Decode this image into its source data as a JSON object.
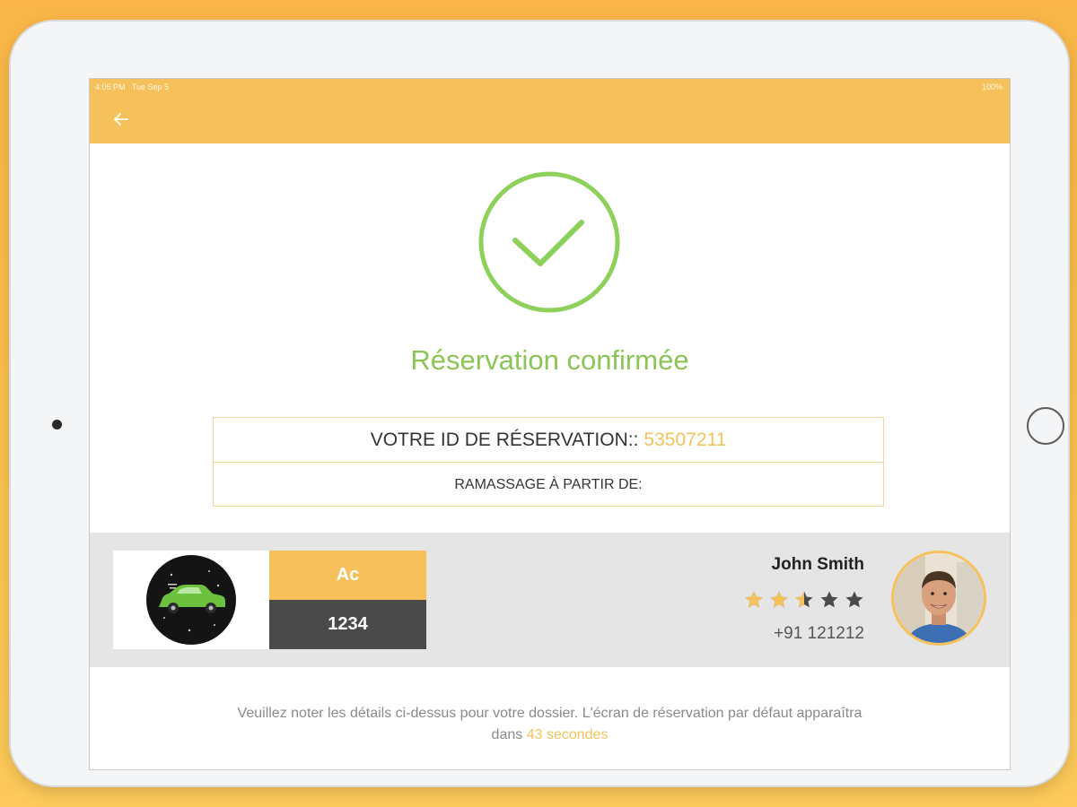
{
  "status_bar": {
    "time": "4:05 PM",
    "date": "Tue Sep 5",
    "battery": "100%"
  },
  "app_bar": {
    "back_icon": "arrow-left-icon"
  },
  "confirmation": {
    "icon": "check-circle-icon",
    "title": "Réservation confirmée",
    "booking_id_label": "VOTRE ID DE RÉSERVATION::",
    "booking_id": "53507211",
    "pickup_label": "RAMASSAGE À PARTIR DE:"
  },
  "vehicle": {
    "icon": "car-icon",
    "type": "Ac",
    "plate": "1234"
  },
  "driver": {
    "name": "John Smith",
    "rating": 2.5,
    "rating_max": 5,
    "phone": "+91 121212",
    "avatar": "driver-avatar"
  },
  "footer": {
    "note_prefix": "Veuillez noter les détails ci-dessus pour votre dossier. L'écran de réservation par défaut apparaîtra dans",
    "countdown": "43 secondes"
  },
  "colors": {
    "accent": "#f6c15a",
    "success": "#8ac555",
    "dark": "#4a4a4a",
    "band": "#e5e5e5"
  }
}
